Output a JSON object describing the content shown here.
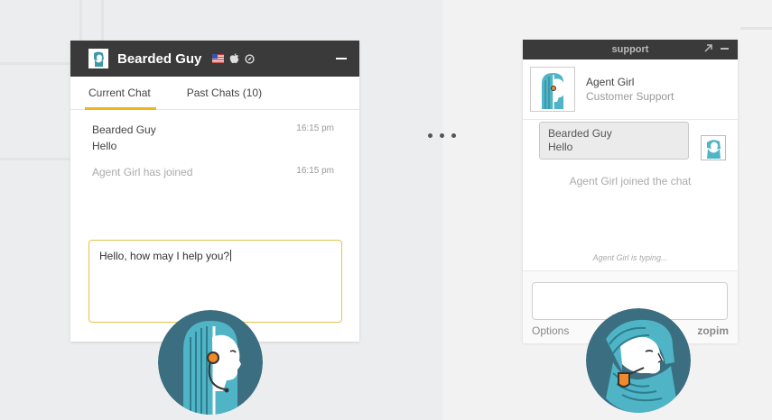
{
  "agent_panel": {
    "visitor_name": "Bearded Guy",
    "tabs": [
      {
        "label": "Current Chat",
        "active": true
      },
      {
        "label": "Past Chats (10)",
        "active": false
      }
    ],
    "messages": [
      {
        "sender": "Bearded Guy",
        "text": "Hello",
        "time": "16:15 pm"
      },
      {
        "system": "Agent Girl has joined",
        "time": "16:15 pm"
      }
    ],
    "reply_text": "Hello, how may I help you?"
  },
  "widget": {
    "title": "support",
    "agent_name": "Agent Girl",
    "agent_role": "Customer Support",
    "visitor_bubble": {
      "sender": "Bearded Guy",
      "text": "Hello"
    },
    "joined_text": "Agent Girl joined the chat",
    "typing_text": "Agent Girl is typing...",
    "options_label": "Options",
    "brand": "zopim"
  },
  "colors": {
    "accent": "#f0b41c",
    "header": "#3a3a3a",
    "avatar_teal": "#3e98a8",
    "avatar_dark": "#3a6e80"
  }
}
